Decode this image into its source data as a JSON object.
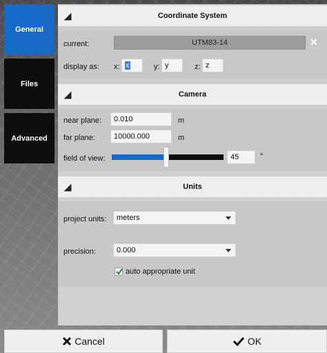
{
  "tabs": [
    {
      "label": "General",
      "active": true
    },
    {
      "label": "Files",
      "active": false
    },
    {
      "label": "Advanced",
      "active": false
    }
  ],
  "coordinate_system": {
    "title": "Coordinate System",
    "current_label": "current:",
    "current_value": "UTM83-14",
    "display_as_label": "display as:",
    "x_label": "x:",
    "x_value": "x",
    "y_label": "y:",
    "y_value": "y",
    "z_label": "z:",
    "z_value": "z"
  },
  "camera": {
    "title": "Camera",
    "near_plane_label": "near plane:",
    "near_plane_value": "0.010",
    "near_plane_unit": "m",
    "far_plane_label": "far plane:",
    "far_plane_value": "10000.000",
    "far_plane_unit": "m",
    "fov_label": "field of view:",
    "fov_value": "45",
    "fov_unit": "°",
    "fov_slider_fraction": 0.49
  },
  "units": {
    "title": "Units",
    "project_units_label": "project units:",
    "project_units_value": "meters",
    "precision_label": "precision:",
    "precision_value": "0.000",
    "auto_unit_label": "auto appropriate unit",
    "auto_unit_checked": true
  },
  "footer": {
    "cancel_label": "Cancel",
    "ok_label": "OK"
  },
  "colors": {
    "accent": "#1769c8",
    "tab_inactive": "#0d0d0d",
    "check": "#2e8b2e"
  }
}
